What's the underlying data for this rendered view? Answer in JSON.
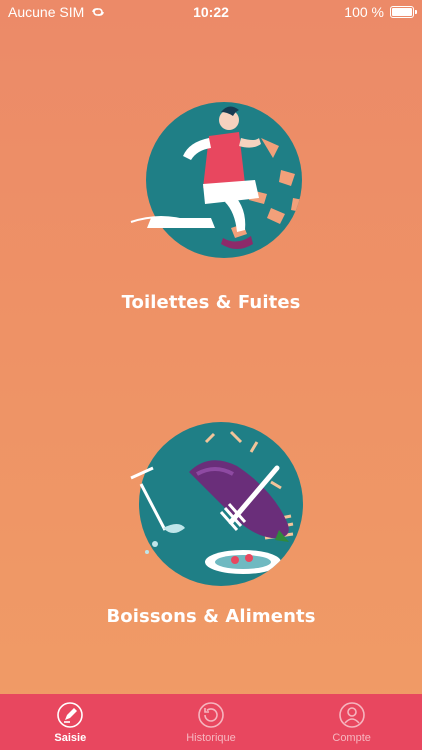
{
  "status_bar": {
    "carrier": "Aucune SIM",
    "time": "10:22",
    "battery_text": "100 %",
    "battery_level": 1.0
  },
  "categories": [
    {
      "label": "Toilettes & Fuites",
      "icon": "toilet-illustration"
    },
    {
      "label": "Boissons & Aliments",
      "icon": "food-drink-illustration"
    }
  ],
  "tab_bar": {
    "tabs": [
      {
        "label": "Saisie",
        "icon": "pencil-icon",
        "active": true
      },
      {
        "label": "Historique",
        "icon": "history-icon",
        "active": false
      },
      {
        "label": "Compte",
        "icon": "user-icon",
        "active": false
      }
    ]
  },
  "colors": {
    "background_top": "#ec8a68",
    "background_bottom": "#f09c66",
    "tab_bar": "#e8475f",
    "illustration_teal": "#1f7f86"
  }
}
